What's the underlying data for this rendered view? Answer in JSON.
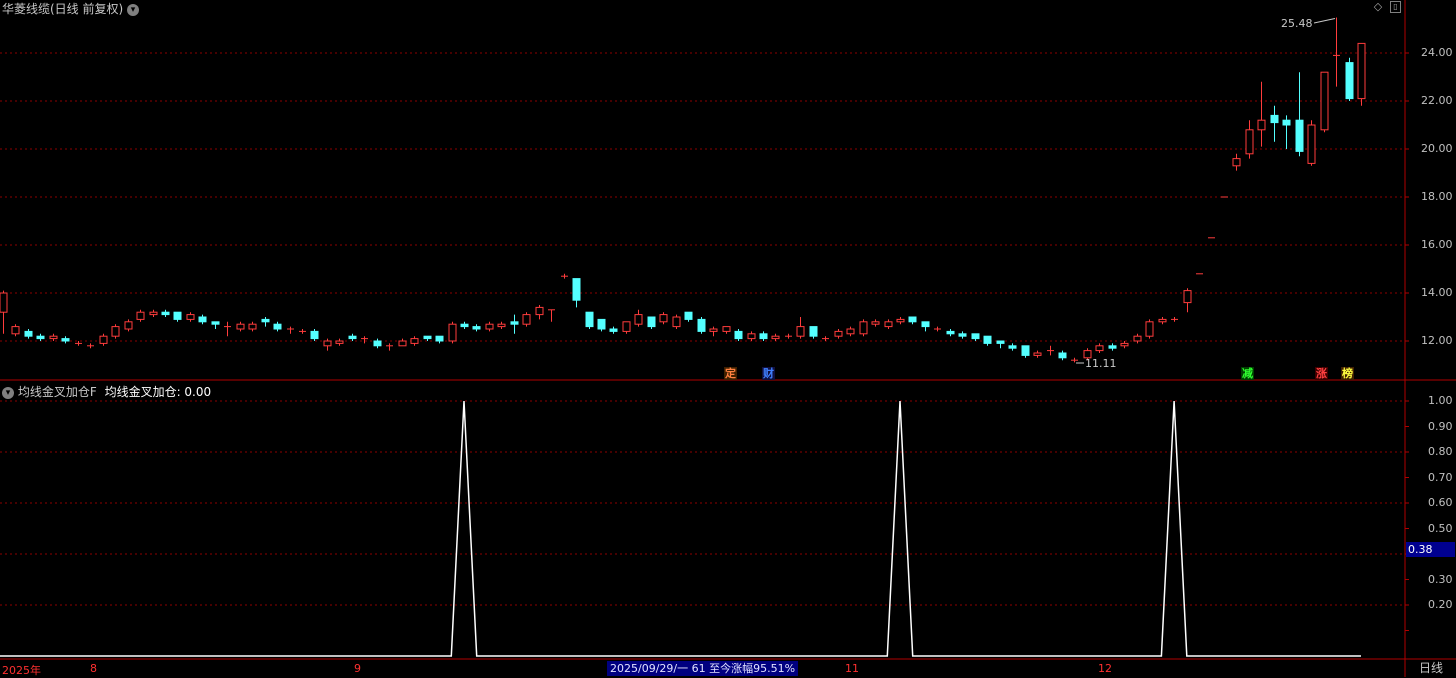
{
  "header": {
    "title": "华菱线缆(日线 前复权)",
    "indicator_title": "均线金叉加仓F",
    "indicator_value_text": "均线金叉加仓: 0.00"
  },
  "annotations": {
    "high_label": "25.48",
    "low_label": "11.11"
  },
  "events": [
    {
      "label": "定",
      "color": "#ff8040",
      "bg": "#402000"
    },
    {
      "label": "财",
      "color": "#4080ff",
      "bg": "#101040"
    },
    {
      "label": "减",
      "color": "#30ff30",
      "bg": "#004000"
    },
    {
      "label": "涨",
      "color": "#ff4040",
      "bg": "#400000"
    },
    {
      "label": "榜",
      "color": "#ffff40",
      "bg": "#402000"
    }
  ],
  "price_axis": [
    "24.00",
    "22.00",
    "20.00",
    "18.00",
    "16.00",
    "14.00",
    "12.00"
  ],
  "indicator_axis": [
    "1.00",
    "0.90",
    "0.80",
    "0.70",
    "0.60",
    "0.50",
    "0.30",
    "0.20"
  ],
  "indicator_cursor": "0.38",
  "date_axis": {
    "year": "2025年",
    "months": [
      "8",
      "9",
      "11",
      "12"
    ],
    "range_info": "2025/09/29/一 61 至今涨幅95.51%"
  },
  "period_tab": "日线",
  "colors": {
    "up": "#ff3c3c",
    "down": "#54ffff",
    "grid": "#8b0000",
    "text": "#c8c8c8"
  },
  "chart_data": {
    "type": "candlestick",
    "title": "华菱线缆(日线 前复权)",
    "price_range": [
      11,
      25.5
    ],
    "candles": [
      [
        13.2,
        14.0,
        14.1,
        12.3
      ],
      [
        12.3,
        12.6,
        12.7,
        12.2
      ],
      [
        12.4,
        12.2,
        12.5,
        12.1
      ],
      [
        12.2,
        12.1,
        12.3,
        12.0
      ],
      [
        12.1,
        12.2,
        12.3,
        12.0
      ],
      [
        12.1,
        12.0,
        12.2,
        11.9
      ],
      [
        11.9,
        11.9,
        12.0,
        11.8
      ],
      [
        11.8,
        11.8,
        11.9,
        11.7
      ],
      [
        11.9,
        12.2,
        12.3,
        11.8
      ],
      [
        12.2,
        12.6,
        12.7,
        12.1
      ],
      [
        12.5,
        12.8,
        12.9,
        12.4
      ],
      [
        12.9,
        13.2,
        13.3,
        12.8
      ],
      [
        13.1,
        13.2,
        13.3,
        13.0
      ],
      [
        13.2,
        13.1,
        13.3,
        13.0
      ],
      [
        13.2,
        12.9,
        13.2,
        12.8
      ],
      [
        12.9,
        13.1,
        13.2,
        12.8
      ],
      [
        13.0,
        12.8,
        13.1,
        12.7
      ],
      [
        12.8,
        12.7,
        12.8,
        12.5
      ],
      [
        12.6,
        12.6,
        12.8,
        12.2
      ],
      [
        12.5,
        12.7,
        12.8,
        12.4
      ],
      [
        12.5,
        12.7,
        12.8,
        12.4
      ],
      [
        12.9,
        12.8,
        13.0,
        12.6
      ],
      [
        12.7,
        12.5,
        12.8,
        12.4
      ],
      [
        12.5,
        12.5,
        12.6,
        12.3
      ],
      [
        12.4,
        12.4,
        12.5,
        12.3
      ],
      [
        12.4,
        12.1,
        12.5,
        12.0
      ],
      [
        11.8,
        12.0,
        12.1,
        11.6
      ],
      [
        11.9,
        12.0,
        12.1,
        11.8
      ],
      [
        12.2,
        12.1,
        12.3,
        12.0
      ],
      [
        12.1,
        12.1,
        12.2,
        11.9
      ],
      [
        12.0,
        11.8,
        12.1,
        11.7
      ],
      [
        11.8,
        11.8,
        11.9,
        11.6
      ],
      [
        11.8,
        12.0,
        12.1,
        11.8
      ],
      [
        11.9,
        12.1,
        12.2,
        11.8
      ],
      [
        12.2,
        12.1,
        12.2,
        12.0
      ],
      [
        12.2,
        12.0,
        12.2,
        11.9
      ],
      [
        12.0,
        12.7,
        12.8,
        11.9
      ],
      [
        12.7,
        12.6,
        12.8,
        12.5
      ],
      [
        12.6,
        12.5,
        12.7,
        12.4
      ],
      [
        12.5,
        12.7,
        12.8,
        12.4
      ],
      [
        12.6,
        12.7,
        12.8,
        12.5
      ],
      [
        12.8,
        12.7,
        13.1,
        12.3
      ],
      [
        12.7,
        13.1,
        13.2,
        12.6
      ],
      [
        13.1,
        13.4,
        13.5,
        12.9
      ],
      [
        13.3,
        13.3,
        13.3,
        12.8
      ],
      [
        14.7,
        14.7,
        14.8,
        14.6
      ],
      [
        14.6,
        13.7,
        14.6,
        13.4
      ],
      [
        13.2,
        12.6,
        13.2,
        12.5
      ],
      [
        12.9,
        12.5,
        12.9,
        12.4
      ],
      [
        12.5,
        12.4,
        12.6,
        12.3
      ],
      [
        12.4,
        12.8,
        12.8,
        12.3
      ],
      [
        12.7,
        13.1,
        13.3,
        12.6
      ],
      [
        13.0,
        12.6,
        13.0,
        12.5
      ],
      [
        12.8,
        13.1,
        13.2,
        12.7
      ],
      [
        12.6,
        13.0,
        13.1,
        12.5
      ],
      [
        13.2,
        12.9,
        13.2,
        12.8
      ],
      [
        12.9,
        12.4,
        13.0,
        12.3
      ],
      [
        12.4,
        12.5,
        12.6,
        12.2
      ],
      [
        12.4,
        12.6,
        12.6,
        12.3
      ],
      [
        12.4,
        12.1,
        12.5,
        12.0
      ],
      [
        12.1,
        12.3,
        12.4,
        12.0
      ],
      [
        12.3,
        12.1,
        12.4,
        12.0
      ],
      [
        12.1,
        12.2,
        12.3,
        12.0
      ],
      [
        12.2,
        12.2,
        12.3,
        12.1
      ],
      [
        12.2,
        12.6,
        13.0,
        12.1
      ],
      [
        12.6,
        12.2,
        12.6,
        12.1
      ],
      [
        12.1,
        12.1,
        12.2,
        12.0
      ],
      [
        12.2,
        12.4,
        12.5,
        12.1
      ],
      [
        12.3,
        12.5,
        12.6,
        12.2
      ],
      [
        12.3,
        12.8,
        12.9,
        12.2
      ],
      [
        12.7,
        12.8,
        12.9,
        12.6
      ],
      [
        12.6,
        12.8,
        12.9,
        12.5
      ],
      [
        12.8,
        12.9,
        13.0,
        12.7
      ],
      [
        13.0,
        12.8,
        13.0,
        12.7
      ],
      [
        12.8,
        12.6,
        12.8,
        12.4
      ],
      [
        12.5,
        12.5,
        12.6,
        12.4
      ],
      [
        12.4,
        12.3,
        12.5,
        12.2
      ],
      [
        12.3,
        12.2,
        12.4,
        12.1
      ],
      [
        12.3,
        12.1,
        12.3,
        12.0
      ],
      [
        12.2,
        11.9,
        12.2,
        11.8
      ],
      [
        12.0,
        11.9,
        12.0,
        11.7
      ],
      [
        11.8,
        11.7,
        11.9,
        11.6
      ],
      [
        11.8,
        11.4,
        11.8,
        11.3
      ],
      [
        11.4,
        11.5,
        11.6,
        11.3
      ],
      [
        11.6,
        11.6,
        11.8,
        11.4
      ],
      [
        11.5,
        11.3,
        11.6,
        11.2
      ],
      [
        11.2,
        11.2,
        11.3,
        11.11
      ],
      [
        11.3,
        11.6,
        11.7,
        11.2
      ],
      [
        11.6,
        11.8,
        11.9,
        11.5
      ],
      [
        11.8,
        11.7,
        11.9,
        11.6
      ],
      [
        11.8,
        11.9,
        12.0,
        11.7
      ],
      [
        12.0,
        12.2,
        12.3,
        11.9
      ],
      [
        12.2,
        12.8,
        12.9,
        12.1
      ],
      [
        12.8,
        12.9,
        13.0,
        12.7
      ],
      [
        12.9,
        12.9,
        13.0,
        12.8
      ],
      [
        13.6,
        14.1,
        14.2,
        13.2
      ],
      [
        14.8,
        14.8,
        14.8,
        14.8
      ],
      [
        16.3,
        16.3,
        16.3,
        16.3
      ],
      [
        18.0,
        18.0,
        18.0,
        18.0
      ],
      [
        19.3,
        19.6,
        19.8,
        19.1
      ],
      [
        19.8,
        20.8,
        21.2,
        19.6
      ],
      [
        20.8,
        21.2,
        22.8,
        20.1
      ],
      [
        21.4,
        21.1,
        21.8,
        20.3
      ],
      [
        21.2,
        21.0,
        21.4,
        20.0
      ],
      [
        21.2,
        19.9,
        23.2,
        19.7
      ],
      [
        19.4,
        21.0,
        21.2,
        19.3
      ],
      [
        20.8,
        23.2,
        23.2,
        20.7
      ],
      [
        23.9,
        23.9,
        25.48,
        22.6
      ],
      [
        23.6,
        22.1,
        23.8,
        22.0
      ],
      [
        22.1,
        24.4,
        24.4,
        21.8
      ]
    ],
    "indicator": {
      "name": "均线金叉加仓",
      "ylim": [
        0,
        1
      ],
      "values": [
        0,
        0,
        0,
        0,
        0,
        0,
        0,
        0,
        0,
        0,
        0,
        0,
        0,
        0,
        0,
        0,
        0,
        0,
        0,
        0,
        0,
        0,
        0,
        0,
        0,
        0,
        0,
        0,
        0,
        0,
        0,
        0,
        0,
        0,
        0,
        0,
        0,
        1,
        0,
        0,
        0,
        0,
        0,
        0,
        0,
        0,
        0,
        0,
        0,
        0,
        0,
        0,
        0,
        0,
        0,
        0,
        0,
        0,
        0,
        0,
        0,
        0,
        0,
        0,
        0,
        0,
        0,
        0,
        0,
        0,
        0,
        0,
        1,
        0,
        0,
        0,
        0,
        0,
        0,
        0,
        0,
        0,
        0,
        0,
        0,
        0,
        0,
        0,
        0,
        0,
        0,
        0,
        0,
        0,
        1,
        0,
        0,
        0,
        0,
        0,
        0,
        0,
        0,
        0,
        0,
        0,
        0,
        0,
        0,
        0,
        0,
        0,
        0,
        0
      ]
    }
  }
}
